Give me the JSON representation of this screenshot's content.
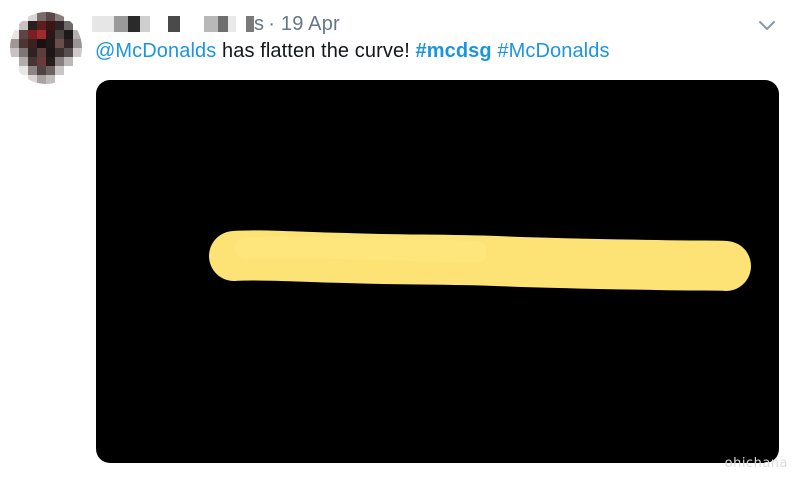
{
  "tweet": {
    "author_suffix": "s",
    "separator": "·",
    "timestamp": "19 Apr",
    "text": {
      "mention": "@McDonalds",
      "body": " has flatten the curve! ",
      "hashtag_1": "#mcdsg",
      "space": " ",
      "hashtag_2": "#McDonalds"
    }
  },
  "watermark": "ohichana",
  "colors": {
    "link": "#1b95e0",
    "text": "#14171a",
    "muted": "#657786",
    "media_bg": "#000000",
    "fry_stroke": "#fde376"
  },
  "icons": {
    "more": "chevron-down-icon"
  }
}
